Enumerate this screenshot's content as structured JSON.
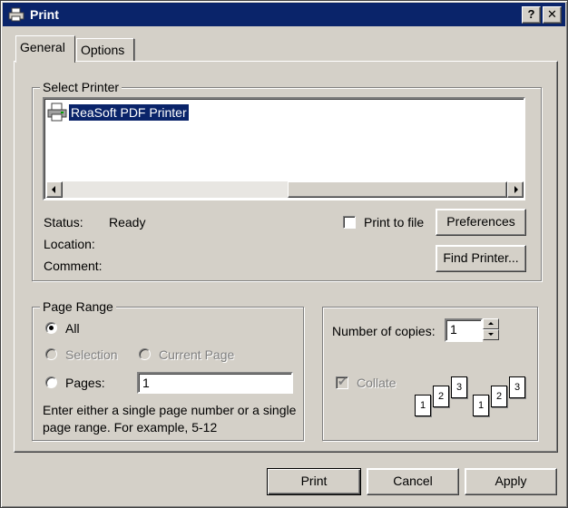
{
  "window": {
    "title": "Print",
    "help_label": "?",
    "close_label": "✕"
  },
  "tabs": [
    {
      "label": "General",
      "selected": true
    },
    {
      "label": "Options",
      "selected": false
    }
  ],
  "select_printer": {
    "group_label": "Select Printer",
    "printers": [
      {
        "name": "ReaSoft PDF Printer",
        "selected": true,
        "icon": "printer-icon"
      }
    ],
    "status_label": "Status:",
    "status_value": "Ready",
    "location_label": "Location:",
    "location_value": "",
    "comment_label": "Comment:",
    "comment_value": "",
    "print_to_file_label": "Print to file",
    "print_to_file_checked": false,
    "preferences_label": "Preferences",
    "find_printer_label": "Find Printer..."
  },
  "page_range": {
    "group_label": "Page Range",
    "all_label": "All",
    "selection_label": "Selection",
    "current_page_label": "Current Page",
    "pages_label": "Pages:",
    "pages_value": "1",
    "selected_option": "All",
    "help_text": "Enter either a single page number or a single page range.  For example, 5-12"
  },
  "copies": {
    "number_label": "Number of copies:",
    "number_value": "1",
    "collate_label": "Collate",
    "collate_checked": true,
    "collate_pages_a": [
      "1",
      "2",
      "3"
    ],
    "collate_pages_b": [
      "1",
      "2",
      "3"
    ]
  },
  "buttons": {
    "print": "Print",
    "cancel": "Cancel",
    "apply": "Apply"
  },
  "colors": {
    "titlebar": "#0a246a",
    "face": "#d4d0c8",
    "selection": "#0a246a"
  }
}
